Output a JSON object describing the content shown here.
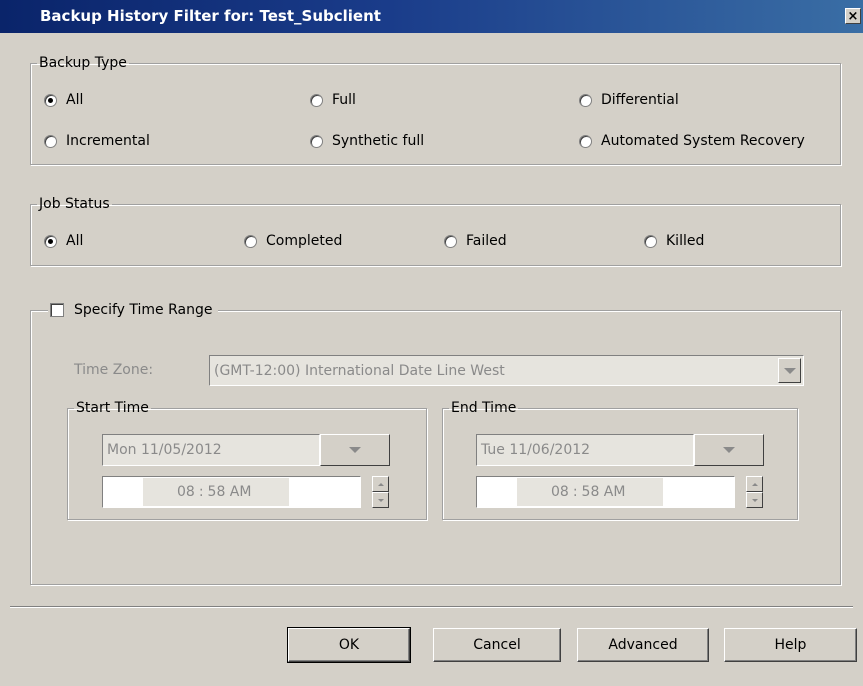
{
  "dialog": {
    "title": "Backup History Filter for: Test_Subclient",
    "close_glyph": "×"
  },
  "backup_type": {
    "legend": "Backup Type",
    "options": [
      {
        "label": "All",
        "selected": true
      },
      {
        "label": "Full",
        "selected": false
      },
      {
        "label": "Differential",
        "selected": false
      },
      {
        "label": "Incremental",
        "selected": false
      },
      {
        "label": "Synthetic full",
        "selected": false
      },
      {
        "label": "Automated System Recovery",
        "selected": false
      }
    ]
  },
  "job_status": {
    "legend": "Job Status",
    "options": [
      {
        "label": "All",
        "selected": true
      },
      {
        "label": "Completed",
        "selected": false
      },
      {
        "label": "Failed",
        "selected": false
      },
      {
        "label": "Killed",
        "selected": false
      }
    ]
  },
  "time_range": {
    "checkbox_label": "Specify Time Range",
    "checked": false,
    "time_zone_label": "Time Zone:",
    "time_zone_value": "(GMT-12:00) International Date Line West",
    "start": {
      "legend": "Start Time",
      "date": "Mon 11/05/2012",
      "hour": "08",
      "colon": ":",
      "minute_ampm": "58 AM"
    },
    "end": {
      "legend": "End Time",
      "date": "Tue 11/06/2012",
      "hour": "08",
      "colon": ":",
      "minute_ampm": "58 AM"
    }
  },
  "buttons": {
    "ok": "OK",
    "cancel": "Cancel",
    "advanced": "Advanced",
    "help": "Help"
  }
}
